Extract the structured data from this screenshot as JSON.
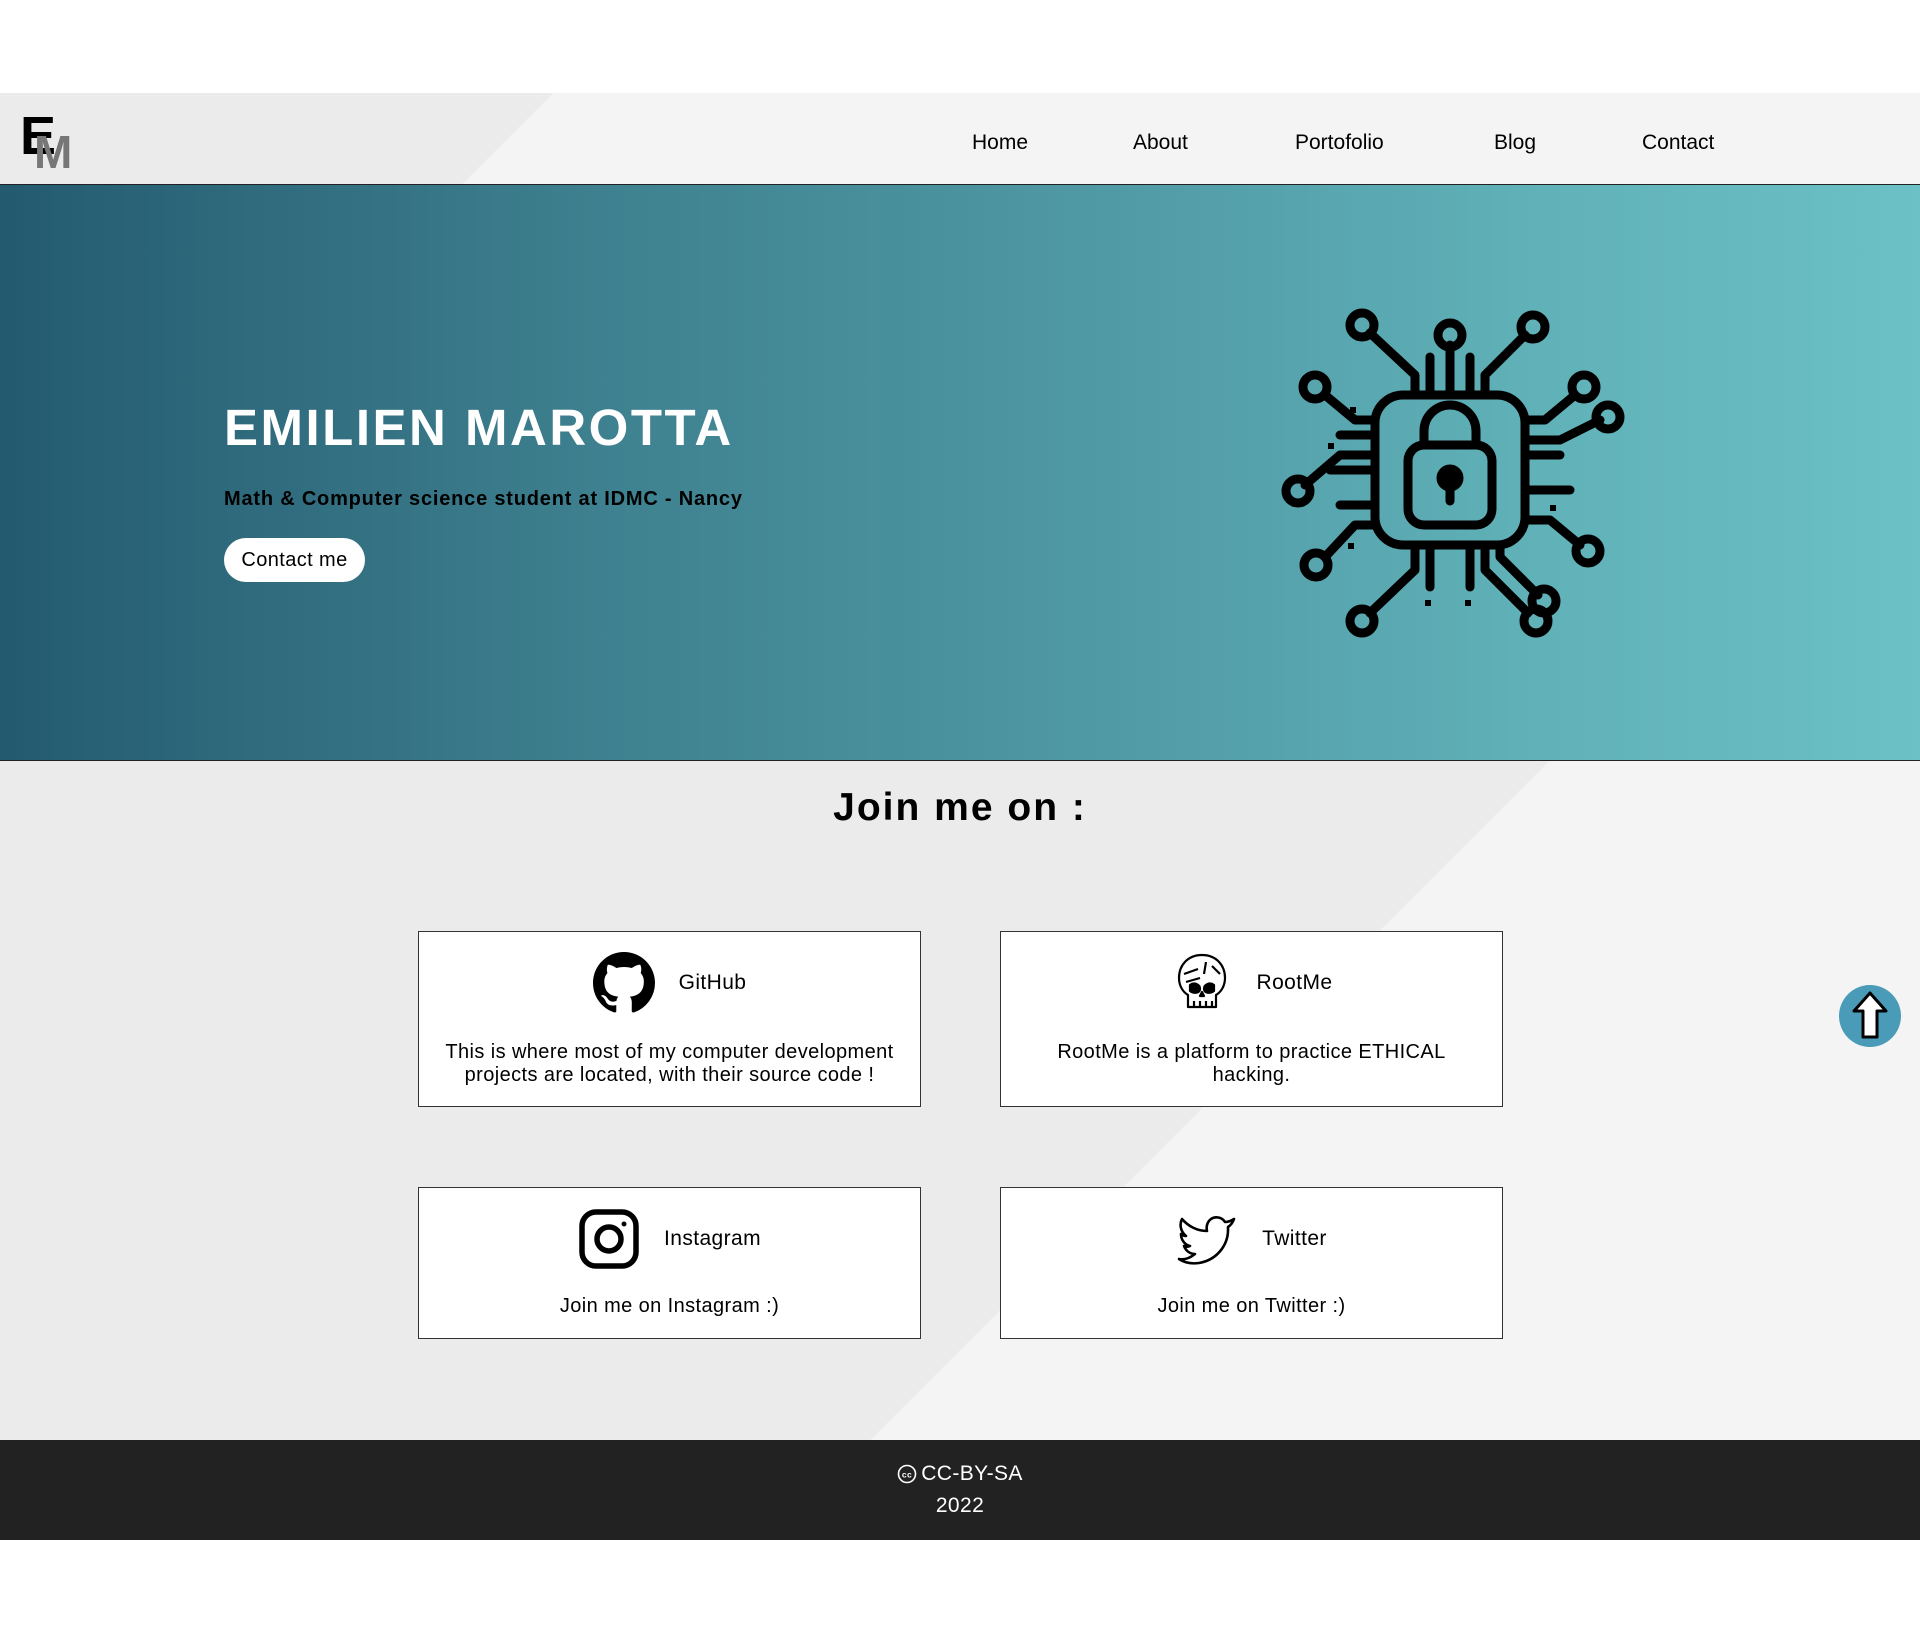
{
  "brand": {
    "logo_letter_1": "E",
    "logo_letter_2": "M"
  },
  "nav": {
    "items": [
      {
        "label": "Home"
      },
      {
        "label": "About"
      },
      {
        "label": "Portofolio"
      },
      {
        "label": "Blog"
      },
      {
        "label": "Contact"
      }
    ]
  },
  "hero": {
    "title": "EMILIEN MAROTTA",
    "subtitle": "Math & Computer science student at IDMC - Nancy",
    "cta_label": "Contact me",
    "art_icon": "circuit-lock-icon"
  },
  "join": {
    "title": "Join me on :",
    "cards": [
      {
        "name": "GitHub",
        "icon": "github-icon",
        "desc_line_1": "This is where most of my computer development",
        "desc_line_2": "projects are located, with their source code !"
      },
      {
        "name": "RootMe",
        "icon": "rootme-skull-icon",
        "desc_line_1": "RootMe is a platform to practice ETHICAL",
        "desc_line_2": "hacking."
      },
      {
        "name": "Instagram",
        "icon": "instagram-icon",
        "desc_line_1": "Join me on Instagram :)",
        "desc_line_2": ""
      },
      {
        "name": "Twitter",
        "icon": "twitter-bird-icon",
        "desc_line_1": "Join me on Twitter :)",
        "desc_line_2": ""
      }
    ]
  },
  "scroll_top": {
    "icon": "arrow-up-icon"
  },
  "footer": {
    "license_icon": "creative-commons-icon",
    "license": "CC-BY-SA",
    "year": "2022"
  },
  "colors": {
    "hero_start": "#245a70",
    "hero_end": "#6bc1c5",
    "footer_bg": "#222222",
    "scroll_button": "#4a9bb7"
  }
}
